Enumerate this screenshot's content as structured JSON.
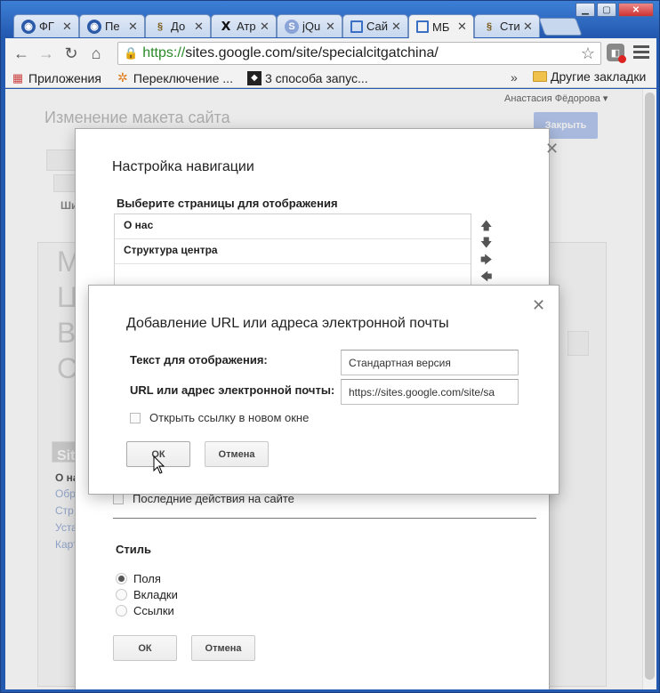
{
  "browser": {
    "tabs": [
      {
        "title": "ФГ",
        "icon": "chrome-globe-icon",
        "active": false
      },
      {
        "title": "Пе",
        "icon": "chrome-globe-icon",
        "active": false
      },
      {
        "title": "До",
        "icon": "google-sites-icon",
        "active": false
      },
      {
        "title": "Атр",
        "icon": "x-site-icon",
        "active": false
      },
      {
        "title": "jQu",
        "icon": "s-circle-icon",
        "active": false
      },
      {
        "title": "Сай",
        "icon": "sites-page-icon",
        "active": false
      },
      {
        "title": "МБ",
        "icon": "sites-page-icon",
        "active": true
      },
      {
        "title": "Сти",
        "icon": "google-sites-icon",
        "active": false
      }
    ],
    "url_scheme": "https://",
    "url_rest": "sites.google.com/site/specialcitgatchina/",
    "bookmarks": [
      {
        "label": "Приложения",
        "icon": "apps-grid-icon"
      },
      {
        "label": "Переключение ...",
        "icon": "joomla-icon"
      },
      {
        "label": "3 способа запус...",
        "icon": "diamond-icon"
      }
    ],
    "more_label": "»",
    "other_bookmarks": "Другие закладки"
  },
  "page": {
    "user_name": "Анастасия Фёдорова ▾",
    "title": "Изменение макета сайта",
    "close_button": "Закрыть"
  },
  "nav_dialog": {
    "title": "Настройка навигации",
    "pages_label": "Выберите страницы для отображения",
    "pages": [
      "О нас",
      "Структура центра",
      ""
    ],
    "recent_activity": "Последние действия на сайте",
    "style_label": "Стиль",
    "style_options": [
      {
        "label": "Поля",
        "selected": true
      },
      {
        "label": "Вкладки",
        "selected": false
      },
      {
        "label": "Ссылки",
        "selected": false
      }
    ],
    "ok": "ОК",
    "cancel": "Отмена"
  },
  "url_dialog": {
    "title": "Добавление URL или адреса электронной почты",
    "text_label": "Текст для отображения:",
    "text_value": "Стандартная версия",
    "url_label": "URL или адрес электронной почты:",
    "url_value": "https://sites.google.com/site/sa",
    "new_window": "Открыть ссылку в новом окне",
    "ok": "ОК",
    "cancel": "Отмена"
  },
  "background_fragments": {
    "big_letters": [
      "М",
      "Ц",
      "В",
      "С"
    ],
    "sidebar": [
      "Sit",
      "О на",
      "Обр",
      "Стр",
      "Уста",
      "Карт"
    ],
    "tools": "Ши"
  },
  "colors": {
    "chrome_frame": "#2459b0",
    "url_green": "#2a8a2a",
    "primary_button": "#b7c9f0"
  }
}
